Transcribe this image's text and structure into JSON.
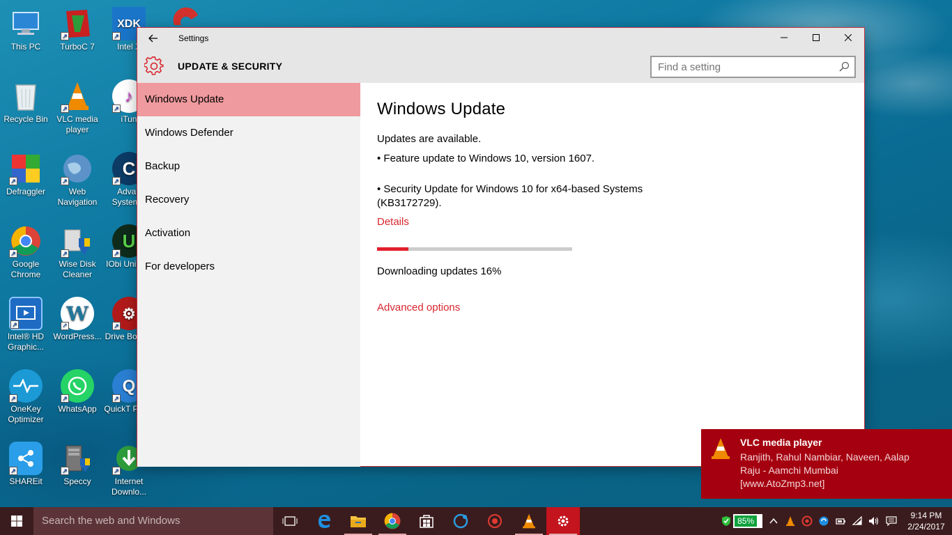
{
  "desktop": {
    "icons": [
      {
        "label": "This PC"
      },
      {
        "label": "TurboC 7"
      },
      {
        "label": "Intel X"
      },
      {
        "label": "Recycle Bin"
      },
      {
        "label": "VLC media player"
      },
      {
        "label": "iTun"
      },
      {
        "label": "Defraggler"
      },
      {
        "label": "Web Navigation"
      },
      {
        "label": "Advan SystemC"
      },
      {
        "label": "Google Chrome"
      },
      {
        "label": "Wise Disk Cleaner"
      },
      {
        "label": "IObi Uninsta"
      },
      {
        "label": "Intel® HD Graphic..."
      },
      {
        "label": "WordPress..."
      },
      {
        "label": "Drive Booste"
      },
      {
        "label": "OneKey Optimizer"
      },
      {
        "label": "WhatsApp"
      },
      {
        "label": "QuickT Playe"
      },
      {
        "label": "SHAREit"
      },
      {
        "label": "Speccy"
      },
      {
        "label": "Internet Downlo..."
      }
    ]
  },
  "window": {
    "title": "Settings",
    "section_title": "UPDATE & SECURITY",
    "search_placeholder": "Find a setting",
    "nav": [
      {
        "label": "Windows Update"
      },
      {
        "label": "Windows Defender"
      },
      {
        "label": "Backup"
      },
      {
        "label": "Recovery"
      },
      {
        "label": "Activation"
      },
      {
        "label": "For developers"
      }
    ],
    "content": {
      "heading": "Windows Update",
      "status": "Updates are available.",
      "update1": "• Feature update to Windows 10, version 1607.",
      "update2_line1": "• Security Update for Windows 10 for x64-based Systems",
      "update2_line2": "(KB3172729).",
      "details_link": "Details",
      "progress_percent": 16,
      "download_status": "Downloading updates 16%",
      "advanced_link": "Advanced options"
    }
  },
  "toast": {
    "title": "VLC media player",
    "line1": "Ranjith, Rahul Nambiar, Naveen, Aalap",
    "line2": "Raju - Aamchi Mumbai",
    "line3": "[www.AtoZmp3.net]"
  },
  "taskbar": {
    "search_placeholder": "Search the web and Windows",
    "battery_percent": "85%",
    "time": "9:14 PM",
    "date": "2/24/2017"
  },
  "colors": {
    "accent": "#d8252d",
    "nav_active": "#ef9a9e",
    "toast_bg": "#a5000f",
    "taskbar_bg": "#3b1c1e"
  }
}
